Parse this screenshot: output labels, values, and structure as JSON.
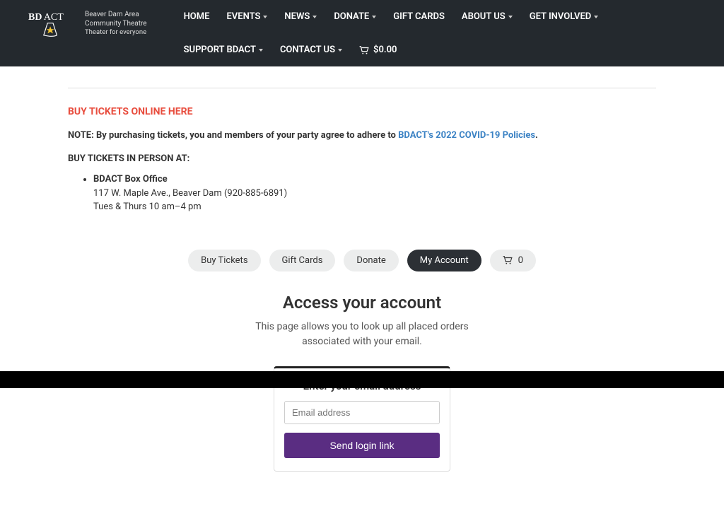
{
  "brand": {
    "line1": "Beaver Dam Area",
    "line2": "Community Theatre",
    "line3": "Theater for everyone"
  },
  "nav": {
    "home": "HOME",
    "events": "EVENTS",
    "news": "NEWS",
    "donate": "DONATE",
    "giftcards": "GIFT CARDS",
    "about": "ABOUT US",
    "getinvolved": "GET INVOLVED",
    "support": "SUPPORT BDACT",
    "contact": "CONTACT US",
    "cart_amount": "$0.00"
  },
  "main": {
    "buy_online": "BUY TICKETS ONLINE HERE",
    "note_prefix": "NOTE: By purchasing tickets, you and members of your party agree to adhere to ",
    "policy_link": "BDACT's 2022 COVID-19 Policies",
    "note_suffix": ".",
    "inperson_head": "BUY TICKETS IN PERSON AT:",
    "office_name": "BDACT Box Office",
    "office_addr": "117 W. Maple Ave., Beaver Dam (920-885-6891)",
    "office_hours": "Tues & Thurs 10 am–4 pm"
  },
  "pills": {
    "buy": "Buy Tickets",
    "gift": "Gift Cards",
    "donate": "Donate",
    "account": "My Account",
    "cart_count": "0"
  },
  "account": {
    "heading": "Access your account",
    "desc1": "This page allows you to look up all placed orders",
    "desc2": "associated with your email.",
    "card_head": "Enter your email address",
    "placeholder": "Email address",
    "button": "Send login link"
  }
}
